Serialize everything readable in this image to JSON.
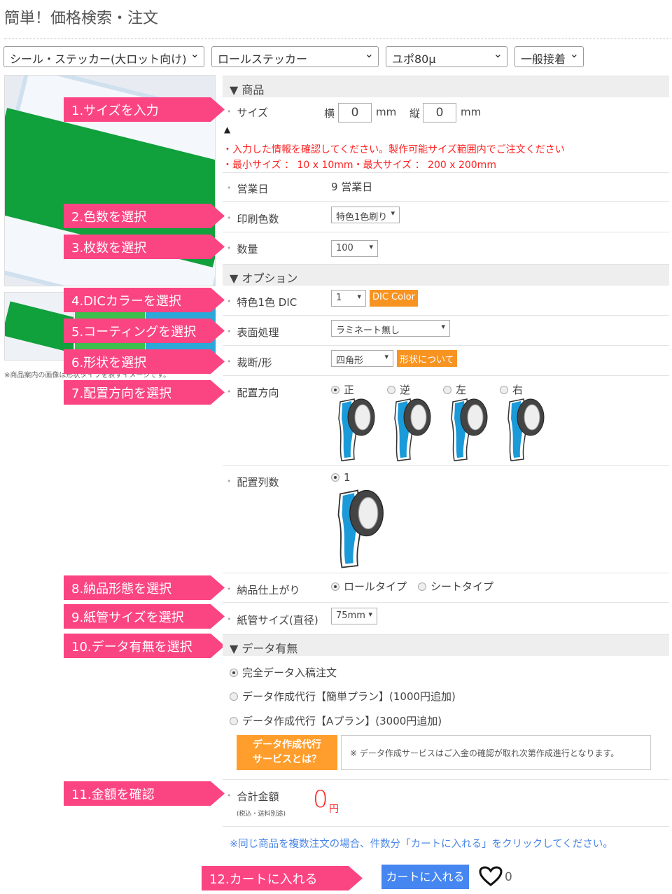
{
  "title": "簡単！価格検索・注文",
  "top_selects": [
    "シール・ステッカー(大ロット向け)",
    "ロールステッカー",
    "ユポ80μ",
    "一般接着"
  ],
  "image_note": "※商品案内の画像は形状タイプを表すイメージです。",
  "steps": [
    "1.サイズを入力",
    "2.色数を選択",
    "3.枚数を選択",
    "4.DICカラーを選択",
    "5.コーティングを選択",
    "6.形状を選択",
    "7.配置方向を選択",
    "8.納品形態を選択",
    "9.紙管サイズを選択",
    "10.データ有無を選択",
    "11.金額を確認",
    "12.カートに入れる"
  ],
  "sections": {
    "product": "▼ 商品",
    "option": "▼ オプション",
    "data": "▼ データ有無"
  },
  "size": {
    "label": "サイズ",
    "w_label": "横",
    "w_value": "0",
    "h_label": "縦",
    "h_value": "0",
    "unit": "mm",
    "warning_icon": "warning-icon",
    "msg1": "・入力した情報を確認してください。製作可能サイズ範囲内でご注文ください",
    "msg2": "・最小サイズ ： 10 x 10mm・最大サイズ ： 200 x 200mm"
  },
  "business_days": {
    "label": "営業日",
    "value": "9 営業日"
  },
  "colors": {
    "label": "印刷色数",
    "value": "特色1色刷り"
  },
  "quantity": {
    "label": "数量",
    "value": "100"
  },
  "dic": {
    "label": "特色1色 DIC",
    "value": "1",
    "button": "DIC Color"
  },
  "surface": {
    "label": "表面処理",
    "value": "ラミネート無し"
  },
  "shape": {
    "label": "裁断/形",
    "value": "四角形",
    "button": "形状について"
  },
  "direction": {
    "label": "配置方向",
    "options": [
      "正",
      "逆",
      "左",
      "右"
    ],
    "selected": "正"
  },
  "columns": {
    "label": "配置列数",
    "options": [
      "1"
    ],
    "selected": "1"
  },
  "delivery": {
    "label": "納品仕上がり",
    "options": [
      "ロールタイプ",
      "シートタイプ"
    ],
    "selected": "ロールタイプ"
  },
  "core": {
    "label": "紙管サイズ(直径)",
    "value": "75mm"
  },
  "data_options": {
    "options": [
      "完全データ入稿注文",
      "データ作成代行【簡単プラン】(1000円追加)",
      "データ作成代行【Aプラン】(3000円追加)"
    ],
    "selected": "完全データ入稿注文",
    "service_button_1": "データ作成代行",
    "service_button_2": "サービスとは？",
    "note": "※ データ作成サービスはご入金の確認が取れ次第作成進行となります。"
  },
  "total": {
    "label": "合計金額",
    "sub": "(税込・送料別途)",
    "value": "0",
    "unit": "円"
  },
  "multi_note": "※同じ商品を複数注文の場合、件数分「カートに入れる」をクリックしてください。",
  "cart": {
    "button": "カートに入れる",
    "favorite_count": "0"
  },
  "colors_theme": {
    "tag": "#fb4583",
    "orange": "#f79421",
    "blue": "#4586f0",
    "red": "#ff2222"
  }
}
